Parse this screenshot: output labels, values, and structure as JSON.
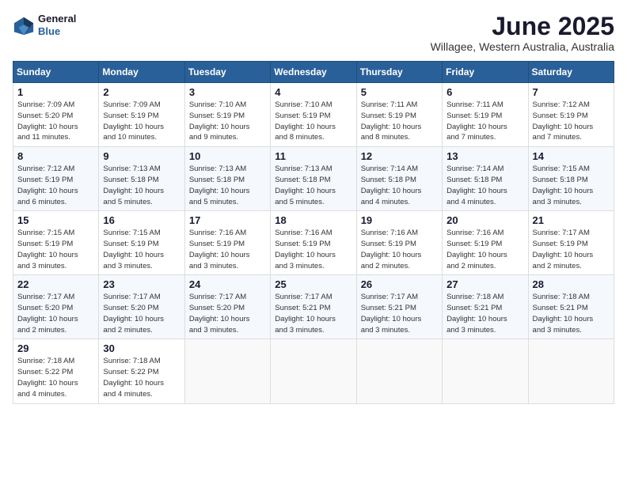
{
  "logo": {
    "general": "General",
    "blue": "Blue"
  },
  "title": "June 2025",
  "location": "Willagee, Western Australia, Australia",
  "weekdays": [
    "Sunday",
    "Monday",
    "Tuesday",
    "Wednesday",
    "Thursday",
    "Friday",
    "Saturday"
  ],
  "weeks": [
    [
      {
        "day": "1",
        "info": "Sunrise: 7:09 AM\nSunset: 5:20 PM\nDaylight: 10 hours\nand 11 minutes."
      },
      {
        "day": "2",
        "info": "Sunrise: 7:09 AM\nSunset: 5:19 PM\nDaylight: 10 hours\nand 10 minutes."
      },
      {
        "day": "3",
        "info": "Sunrise: 7:10 AM\nSunset: 5:19 PM\nDaylight: 10 hours\nand 9 minutes."
      },
      {
        "day": "4",
        "info": "Sunrise: 7:10 AM\nSunset: 5:19 PM\nDaylight: 10 hours\nand 8 minutes."
      },
      {
        "day": "5",
        "info": "Sunrise: 7:11 AM\nSunset: 5:19 PM\nDaylight: 10 hours\nand 8 minutes."
      },
      {
        "day": "6",
        "info": "Sunrise: 7:11 AM\nSunset: 5:19 PM\nDaylight: 10 hours\nand 7 minutes."
      },
      {
        "day": "7",
        "info": "Sunrise: 7:12 AM\nSunset: 5:19 PM\nDaylight: 10 hours\nand 7 minutes."
      }
    ],
    [
      {
        "day": "8",
        "info": "Sunrise: 7:12 AM\nSunset: 5:19 PM\nDaylight: 10 hours\nand 6 minutes."
      },
      {
        "day": "9",
        "info": "Sunrise: 7:13 AM\nSunset: 5:18 PM\nDaylight: 10 hours\nand 5 minutes."
      },
      {
        "day": "10",
        "info": "Sunrise: 7:13 AM\nSunset: 5:18 PM\nDaylight: 10 hours\nand 5 minutes."
      },
      {
        "day": "11",
        "info": "Sunrise: 7:13 AM\nSunset: 5:18 PM\nDaylight: 10 hours\nand 5 minutes."
      },
      {
        "day": "12",
        "info": "Sunrise: 7:14 AM\nSunset: 5:18 PM\nDaylight: 10 hours\nand 4 minutes."
      },
      {
        "day": "13",
        "info": "Sunrise: 7:14 AM\nSunset: 5:18 PM\nDaylight: 10 hours\nand 4 minutes."
      },
      {
        "day": "14",
        "info": "Sunrise: 7:15 AM\nSunset: 5:18 PM\nDaylight: 10 hours\nand 3 minutes."
      }
    ],
    [
      {
        "day": "15",
        "info": "Sunrise: 7:15 AM\nSunset: 5:19 PM\nDaylight: 10 hours\nand 3 minutes."
      },
      {
        "day": "16",
        "info": "Sunrise: 7:15 AM\nSunset: 5:19 PM\nDaylight: 10 hours\nand 3 minutes."
      },
      {
        "day": "17",
        "info": "Sunrise: 7:16 AM\nSunset: 5:19 PM\nDaylight: 10 hours\nand 3 minutes."
      },
      {
        "day": "18",
        "info": "Sunrise: 7:16 AM\nSunset: 5:19 PM\nDaylight: 10 hours\nand 3 minutes."
      },
      {
        "day": "19",
        "info": "Sunrise: 7:16 AM\nSunset: 5:19 PM\nDaylight: 10 hours\nand 2 minutes."
      },
      {
        "day": "20",
        "info": "Sunrise: 7:16 AM\nSunset: 5:19 PM\nDaylight: 10 hours\nand 2 minutes."
      },
      {
        "day": "21",
        "info": "Sunrise: 7:17 AM\nSunset: 5:19 PM\nDaylight: 10 hours\nand 2 minutes."
      }
    ],
    [
      {
        "day": "22",
        "info": "Sunrise: 7:17 AM\nSunset: 5:20 PM\nDaylight: 10 hours\nand 2 minutes."
      },
      {
        "day": "23",
        "info": "Sunrise: 7:17 AM\nSunset: 5:20 PM\nDaylight: 10 hours\nand 2 minutes."
      },
      {
        "day": "24",
        "info": "Sunrise: 7:17 AM\nSunset: 5:20 PM\nDaylight: 10 hours\nand 3 minutes."
      },
      {
        "day": "25",
        "info": "Sunrise: 7:17 AM\nSunset: 5:21 PM\nDaylight: 10 hours\nand 3 minutes."
      },
      {
        "day": "26",
        "info": "Sunrise: 7:17 AM\nSunset: 5:21 PM\nDaylight: 10 hours\nand 3 minutes."
      },
      {
        "day": "27",
        "info": "Sunrise: 7:18 AM\nSunset: 5:21 PM\nDaylight: 10 hours\nand 3 minutes."
      },
      {
        "day": "28",
        "info": "Sunrise: 7:18 AM\nSunset: 5:21 PM\nDaylight: 10 hours\nand 3 minutes."
      }
    ],
    [
      {
        "day": "29",
        "info": "Sunrise: 7:18 AM\nSunset: 5:22 PM\nDaylight: 10 hours\nand 4 minutes."
      },
      {
        "day": "30",
        "info": "Sunrise: 7:18 AM\nSunset: 5:22 PM\nDaylight: 10 hours\nand 4 minutes."
      },
      null,
      null,
      null,
      null,
      null
    ]
  ]
}
